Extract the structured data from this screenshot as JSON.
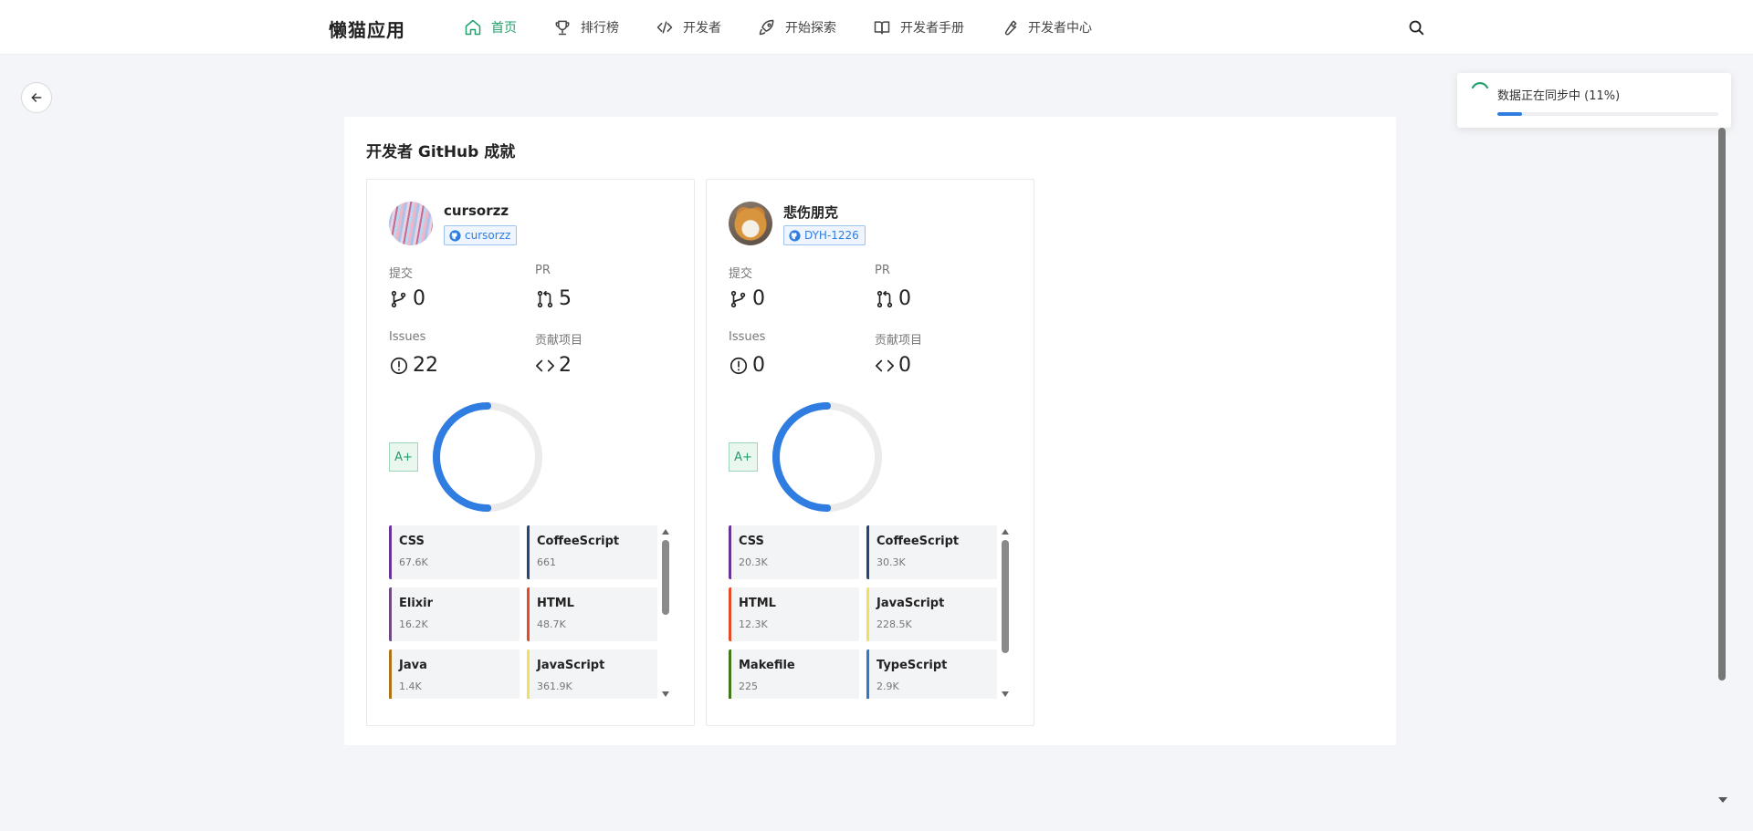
{
  "app": {
    "title": "懒猫应用"
  },
  "nav": [
    {
      "label": "首页",
      "icon": "home-icon",
      "active": true
    },
    {
      "label": "排行榜",
      "icon": "trophy-icon",
      "active": false
    },
    {
      "label": "开发者",
      "icon": "code-icon",
      "active": false
    },
    {
      "label": "开始探索",
      "icon": "rocket-icon",
      "active": false
    },
    {
      "label": "开发者手册",
      "icon": "book-icon",
      "active": false
    },
    {
      "label": "开发者中心",
      "icon": "wrench-icon",
      "active": false
    }
  ],
  "sync": {
    "message": "数据正在同步中 (11%)",
    "progress": 0.11
  },
  "panel": {
    "title": "开发者 GitHub 成就"
  },
  "stat_labels": {
    "commits": "提交",
    "pr": "PR",
    "issues": "Issues",
    "projects": "贡献项目"
  },
  "developers": [
    {
      "name": "cursorzz",
      "github": "cursorzz",
      "commits": "0",
      "pr": "5",
      "issues": "22",
      "projects": "2",
      "grade": "A+",
      "ring_progress": 0.5,
      "langs": [
        {
          "name": "CSS",
          "value": "67.6K",
          "color": "#663399"
        },
        {
          "name": "CoffeeScript",
          "value": "661",
          "color": "#244776"
        },
        {
          "name": "Elixir",
          "value": "16.2K",
          "color": "#6e4a7e"
        },
        {
          "name": "HTML",
          "value": "48.7K",
          "color": "#e34c26"
        },
        {
          "name": "Java",
          "value": "1.4K",
          "color": "#b07219"
        },
        {
          "name": "JavaScript",
          "value": "361.9K",
          "color": "#f1e05a"
        }
      ]
    },
    {
      "name": "悲伤朋克",
      "github": "DYH-1226",
      "commits": "0",
      "pr": "0",
      "issues": "0",
      "projects": "0",
      "grade": "A+",
      "ring_progress": 0.5,
      "langs": [
        {
          "name": "CSS",
          "value": "20.3K",
          "color": "#663399"
        },
        {
          "name": "CoffeeScript",
          "value": "30.3K",
          "color": "#244776"
        },
        {
          "name": "HTML",
          "value": "12.3K",
          "color": "#e34c26"
        },
        {
          "name": "JavaScript",
          "value": "228.5K",
          "color": "#f1e05a"
        },
        {
          "name": "Makefile",
          "value": "225",
          "color": "#427819"
        },
        {
          "name": "TypeScript",
          "value": "2.9K",
          "color": "#3178c6"
        }
      ]
    }
  ],
  "colors": {
    "accent_green": "#22a06b",
    "accent_blue": "#2f7de1"
  }
}
